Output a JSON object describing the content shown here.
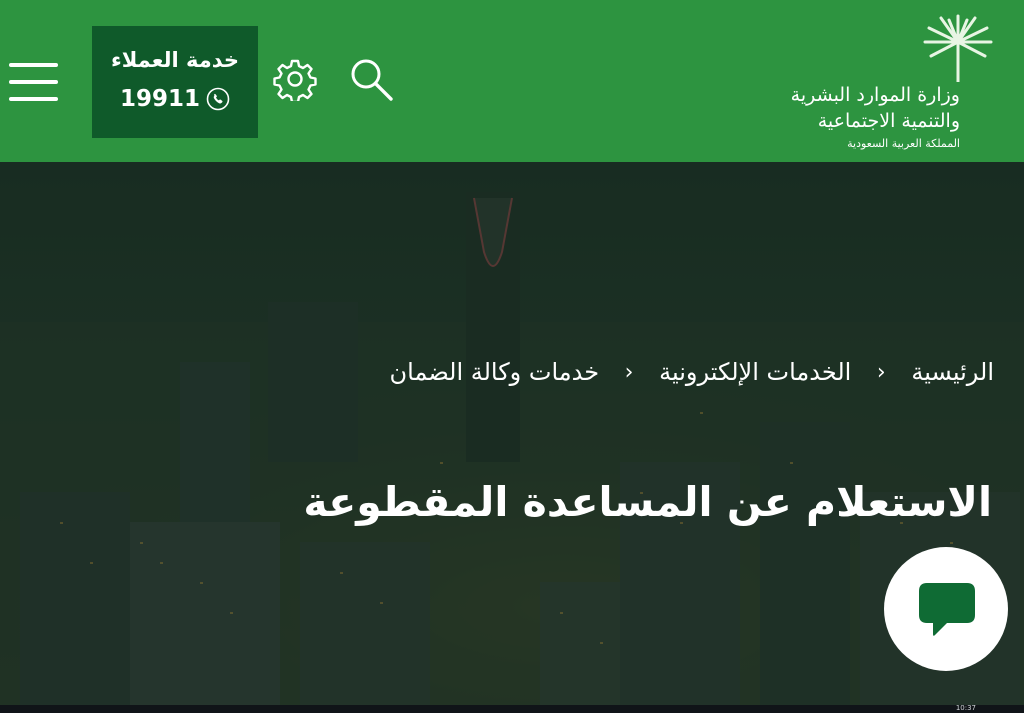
{
  "header": {
    "customer_service": {
      "title": "خدمة العملاء",
      "number": "19911"
    },
    "logo": {
      "line1": "وزارة الموارد البشرية",
      "line2": "والتنمية الاجتماعية",
      "line3": "المملكة العربية السعودية"
    }
  },
  "breadcrumb": {
    "items": [
      "الرئيسية",
      "الخدمات الإلكترونية",
      "خدمات وكالة الضمان"
    ],
    "separator": "‹"
  },
  "page": {
    "title": "الاستعلام عن المساعدة المقطوعة"
  },
  "colors": {
    "header_green": "#2d9440",
    "dark_green": "#0f5a2a",
    "chat_green": "#0f6b34"
  },
  "icons": [
    "menu-icon",
    "phone-icon",
    "gear-icon",
    "search-icon",
    "palm-logo-icon",
    "chat-icon"
  ],
  "taskbar": {
    "time": "10:37"
  }
}
